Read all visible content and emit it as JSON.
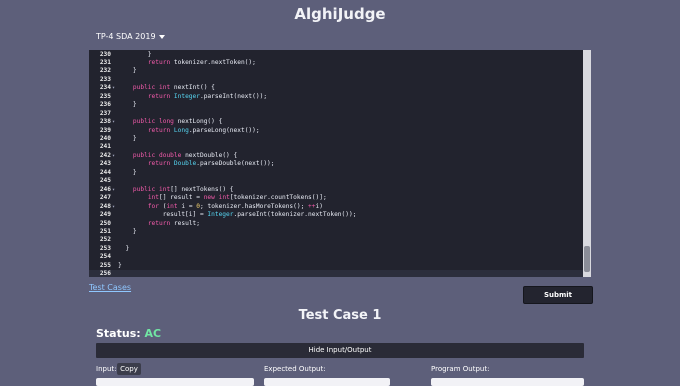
{
  "app": {
    "title": "AlghiJudge"
  },
  "contest": {
    "selected": "TP-4 SDA 2019"
  },
  "editor": {
    "lines": [
      {
        "n": "230",
        "fold": "",
        "segs": [
          [
            "",
            "        }"
          ]
        ]
      },
      {
        "n": "231",
        "fold": "",
        "segs": [
          [
            "",
            "        "
          ],
          [
            "kw",
            "return"
          ],
          [
            "",
            " tokenizer.nextToken();"
          ]
        ]
      },
      {
        "n": "232",
        "fold": "",
        "segs": [
          [
            "",
            "    }"
          ]
        ]
      },
      {
        "n": "233",
        "fold": "",
        "segs": [
          [
            "",
            ""
          ]
        ]
      },
      {
        "n": "234",
        "fold": "▾",
        "segs": [
          [
            "",
            "    "
          ],
          [
            "kw",
            "public"
          ],
          [
            "",
            " "
          ],
          [
            "kw",
            "int"
          ],
          [
            "",
            " nextInt() {"
          ]
        ]
      },
      {
        "n": "235",
        "fold": "",
        "segs": [
          [
            "",
            "        "
          ],
          [
            "kw",
            "return"
          ],
          [
            "",
            " "
          ],
          [
            "ty",
            "Integer"
          ],
          [
            "",
            ".parseInt(next());"
          ]
        ]
      },
      {
        "n": "236",
        "fold": "",
        "segs": [
          [
            "",
            "    }"
          ]
        ]
      },
      {
        "n": "237",
        "fold": "",
        "segs": [
          [
            "",
            ""
          ]
        ]
      },
      {
        "n": "238",
        "fold": "▾",
        "segs": [
          [
            "",
            "    "
          ],
          [
            "kw",
            "public"
          ],
          [
            "",
            " "
          ],
          [
            "kw",
            "long"
          ],
          [
            "",
            " nextLong() {"
          ]
        ]
      },
      {
        "n": "239",
        "fold": "",
        "segs": [
          [
            "",
            "        "
          ],
          [
            "kw",
            "return"
          ],
          [
            "",
            " "
          ],
          [
            "ty",
            "Long"
          ],
          [
            "",
            ".parseLong(next());"
          ]
        ]
      },
      {
        "n": "240",
        "fold": "",
        "segs": [
          [
            "",
            "    }"
          ]
        ]
      },
      {
        "n": "241",
        "fold": "",
        "segs": [
          [
            "",
            ""
          ]
        ]
      },
      {
        "n": "242",
        "fold": "▾",
        "segs": [
          [
            "",
            "    "
          ],
          [
            "kw",
            "public"
          ],
          [
            "",
            " "
          ],
          [
            "kw",
            "double"
          ],
          [
            "",
            " nextDouble() {"
          ]
        ]
      },
      {
        "n": "243",
        "fold": "",
        "segs": [
          [
            "",
            "        "
          ],
          [
            "kw",
            "return"
          ],
          [
            "",
            " "
          ],
          [
            "ty",
            "Double"
          ],
          [
            "",
            ".parseDouble(next());"
          ]
        ]
      },
      {
        "n": "244",
        "fold": "",
        "segs": [
          [
            "",
            "    }"
          ]
        ]
      },
      {
        "n": "245",
        "fold": "",
        "segs": [
          [
            "",
            ""
          ]
        ]
      },
      {
        "n": "246",
        "fold": "▾",
        "segs": [
          [
            "",
            "    "
          ],
          [
            "kw",
            "public"
          ],
          [
            "",
            " "
          ],
          [
            "kw",
            "int"
          ],
          [
            "",
            "[] nextTokens() {"
          ]
        ]
      },
      {
        "n": "247",
        "fold": "",
        "segs": [
          [
            "",
            "        "
          ],
          [
            "kw",
            "int"
          ],
          [
            "",
            "[] result = "
          ],
          [
            "kw",
            "new"
          ],
          [
            "",
            " "
          ],
          [
            "kw",
            "int"
          ],
          [
            "",
            "[tokenizer.countTokens()];"
          ]
        ]
      },
      {
        "n": "248",
        "fold": "▾",
        "segs": [
          [
            "",
            "        "
          ],
          [
            "kw",
            "for"
          ],
          [
            "",
            " ("
          ],
          [
            "kw",
            "int"
          ],
          [
            "",
            " i = "
          ],
          [
            "nm",
            "0"
          ],
          [
            "",
            "; tokenizer.hasMoreTokens(); "
          ],
          [
            "kw",
            "++"
          ],
          [
            "",
            "i)"
          ]
        ]
      },
      {
        "n": "249",
        "fold": "",
        "segs": [
          [
            "",
            "            result[i] = "
          ],
          [
            "ty",
            "Integer"
          ],
          [
            "",
            ".parseInt(tokenizer.nextToken());"
          ]
        ]
      },
      {
        "n": "250",
        "fold": "",
        "segs": [
          [
            "",
            "        "
          ],
          [
            "kw",
            "return"
          ],
          [
            "",
            " result;"
          ]
        ]
      },
      {
        "n": "251",
        "fold": "",
        "segs": [
          [
            "",
            "    }"
          ]
        ]
      },
      {
        "n": "252",
        "fold": "",
        "segs": [
          [
            "",
            ""
          ]
        ]
      },
      {
        "n": "253",
        "fold": "",
        "segs": [
          [
            "",
            "  }"
          ]
        ]
      },
      {
        "n": "254",
        "fold": "",
        "segs": [
          [
            "",
            ""
          ]
        ]
      },
      {
        "n": "255",
        "fold": "",
        "segs": [
          [
            "",
            "}"
          ]
        ]
      },
      {
        "n": "256",
        "fold": "",
        "segs": [
          [
            "",
            ""
          ]
        ]
      }
    ]
  },
  "links": {
    "test_cases": "Test Cases"
  },
  "buttons": {
    "submit": "Submit",
    "hide_io": "Hide Input/Output",
    "copy": "Copy"
  },
  "testcase": {
    "heading": "Test Case 1",
    "status_label": "Status:",
    "status_value": "AC",
    "input_label": "Input:",
    "expected_label": "Expected Output:",
    "program_label": "Program Output:"
  },
  "colors": {
    "background": "#5d5f7a",
    "editor_bg": "#22232e",
    "status_ac": "#71e6a4"
  }
}
